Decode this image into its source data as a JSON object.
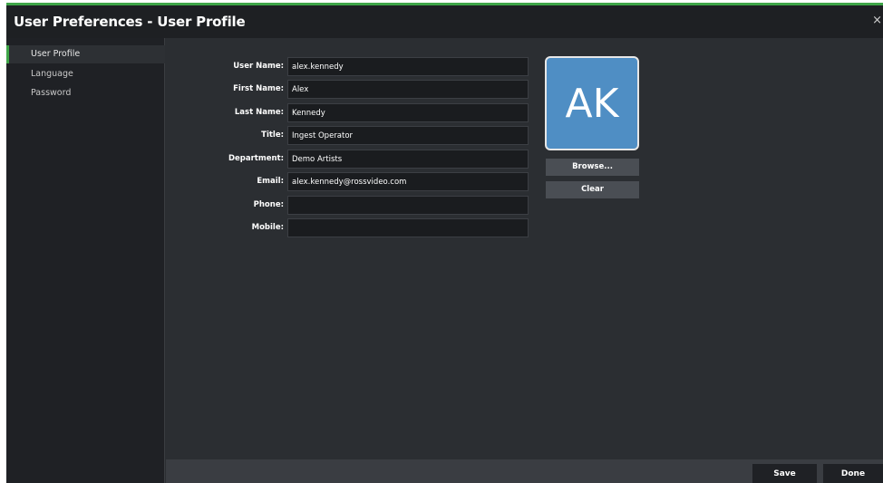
{
  "window": {
    "title": "User Preferences - User Profile",
    "close_label": "×"
  },
  "sidebar": {
    "items": [
      {
        "label": "User Profile",
        "active": true
      },
      {
        "label": "Language",
        "active": false
      },
      {
        "label": "Password",
        "active": false
      }
    ]
  },
  "form": {
    "fields": [
      {
        "label": "User Name:",
        "value": "alex.kennedy"
      },
      {
        "label": "First Name:",
        "value": "Alex"
      },
      {
        "label": "Last Name:",
        "value": "Kennedy"
      },
      {
        "label": "Title:",
        "value": "Ingest Operator"
      },
      {
        "label": "Department:",
        "value": "Demo Artists"
      },
      {
        "label": "Email:",
        "value": "alex.kennedy@rossvideo.com"
      },
      {
        "label": "Phone:",
        "value": ""
      },
      {
        "label": "Mobile:",
        "value": ""
      }
    ]
  },
  "avatar": {
    "initials": "AK",
    "color": "#4f8ec4",
    "browse_label": "Browse...",
    "clear_label": "Clear"
  },
  "footer": {
    "save_label": "Save",
    "done_label": "Done"
  },
  "colors": {
    "accent": "#3fa548",
    "background": "#2b2e32",
    "sidebar": "#1f2125"
  }
}
